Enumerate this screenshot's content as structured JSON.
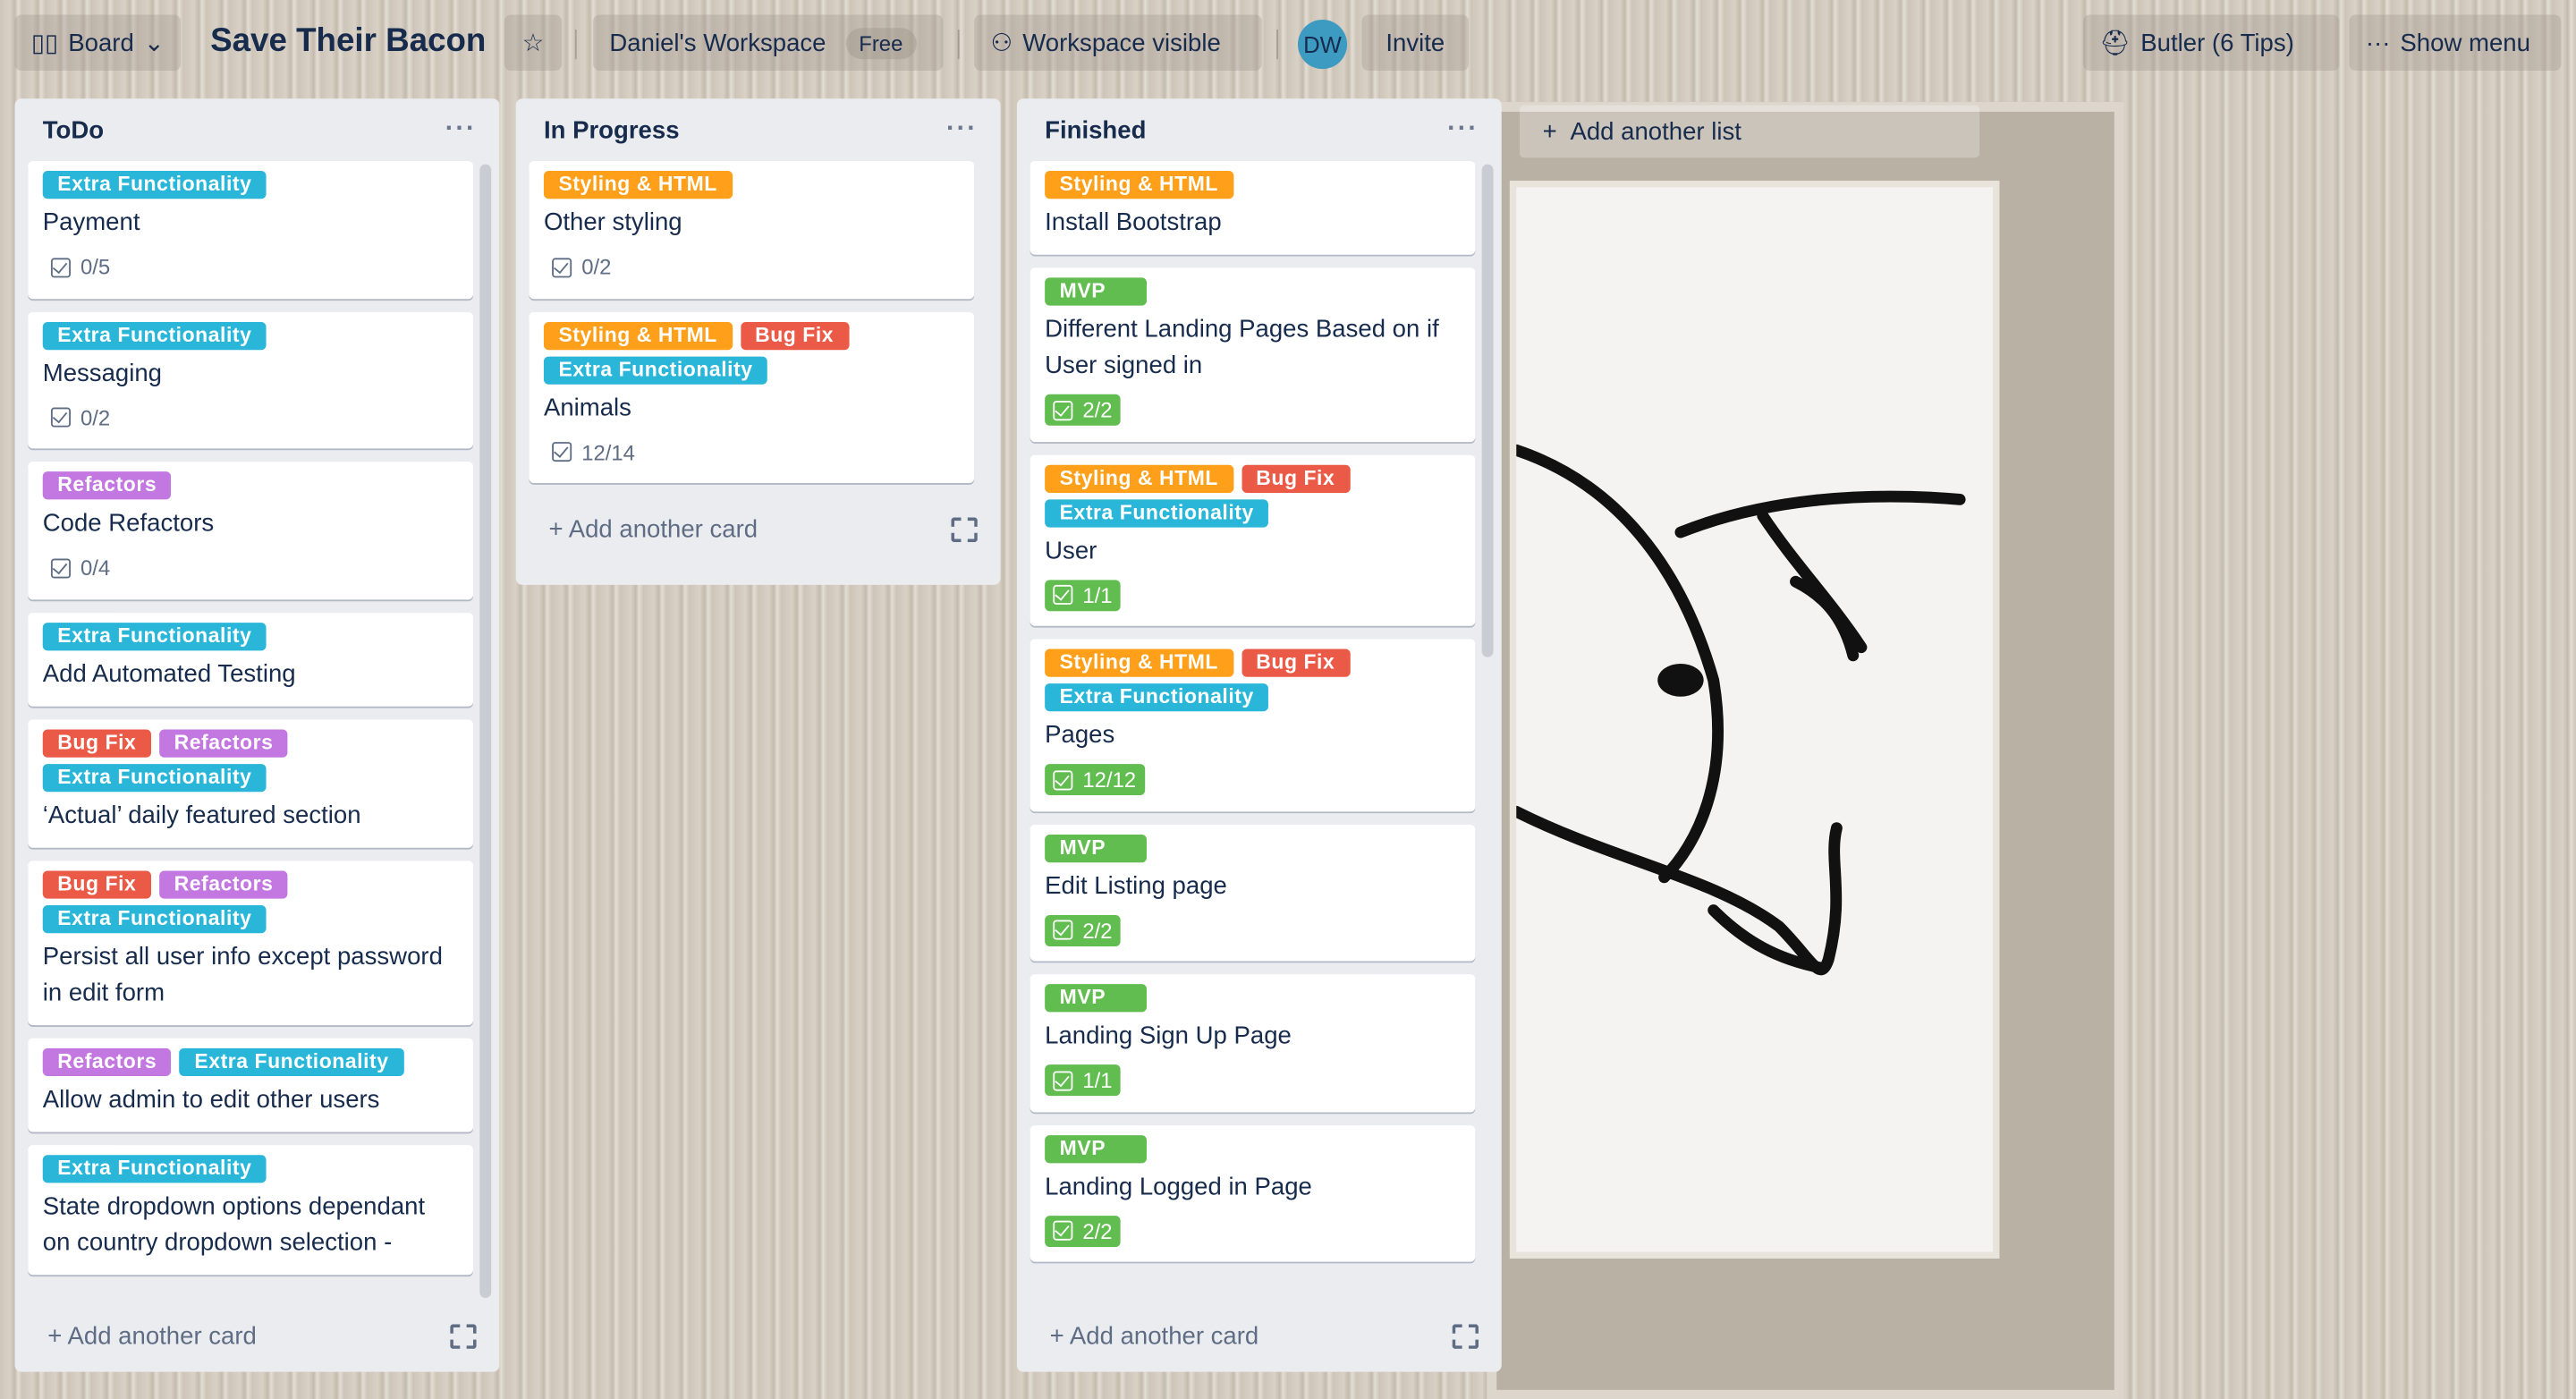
{
  "header": {
    "board_label": "Board",
    "title": "Save Their Bacon",
    "workspace": "Daniel's Workspace",
    "plan": "Free",
    "visibility": "Workspace visible",
    "avatar": "DW",
    "invite": "Invite",
    "butler": "Butler (6 Tips)",
    "show_menu": "Show menu"
  },
  "label_colors": {
    "Extra Functionality": "#29b6d8",
    "Styling & HTML": "#ff9f1a",
    "Bug Fix": "#eb5a46",
    "Refactors": "#c377e0",
    "MVP": "#61bd4f"
  },
  "add_card": "Add another card",
  "add_list": "Add another list",
  "lists": [
    {
      "name": "ToDo",
      "cards": [
        {
          "labels": [
            "Extra Functionality"
          ],
          "title": "Payment",
          "checklist": "0/5",
          "complete": false
        },
        {
          "labels": [
            "Extra Functionality"
          ],
          "title": "Messaging",
          "checklist": "0/2",
          "complete": false
        },
        {
          "labels": [
            "Refactors"
          ],
          "title": "Code Refactors",
          "checklist": "0/4",
          "complete": false
        },
        {
          "labels": [
            "Extra Functionality"
          ],
          "title": "Add Automated Testing"
        },
        {
          "labels": [
            "Bug Fix",
            "Refactors",
            "Extra Functionality"
          ],
          "title": "‘Actual’ daily featured section"
        },
        {
          "labels": [
            "Bug Fix",
            "Refactors",
            "Extra Functionality"
          ],
          "title": "Persist all user info except password in edit form"
        },
        {
          "labels": [
            "Refactors",
            "Extra Functionality"
          ],
          "title": "Allow admin to edit other users"
        },
        {
          "labels": [
            "Extra Functionality"
          ],
          "title": "State dropdown options dependant on country dropdown selection -"
        }
      ]
    },
    {
      "name": "In Progress",
      "cards": [
        {
          "labels": [
            "Styling & HTML"
          ],
          "title": "Other styling",
          "checklist": "0/2",
          "complete": false
        },
        {
          "labels": [
            "Styling & HTML",
            "Bug Fix",
            "Extra Functionality"
          ],
          "title": "Animals",
          "checklist": "12/14",
          "complete": false
        }
      ]
    },
    {
      "name": "Finished",
      "cards": [
        {
          "labels": [
            "Styling & HTML"
          ],
          "title": "Install Bootstrap"
        },
        {
          "labels": [
            "MVP"
          ],
          "title": "Different Landing Pages Based on if User signed in",
          "checklist": "2/2",
          "complete": true
        },
        {
          "labels": [
            "Styling & HTML",
            "Bug Fix",
            "Extra Functionality"
          ],
          "title": "User",
          "checklist": "1/1",
          "complete": true
        },
        {
          "labels": [
            "Styling & HTML",
            "Bug Fix",
            "Extra Functionality"
          ],
          "title": "Pages",
          "checklist": "12/12",
          "complete": true
        },
        {
          "labels": [
            "MVP"
          ],
          "title": "Edit Listing page",
          "checklist": "2/2",
          "complete": true
        },
        {
          "labels": [
            "MVP"
          ],
          "title": "Landing Sign Up Page",
          "checklist": "1/1",
          "complete": true
        },
        {
          "labels": [
            "MVP"
          ],
          "title": "Landing Logged in Page",
          "checklist": "2/2",
          "complete": true
        }
      ]
    }
  ]
}
